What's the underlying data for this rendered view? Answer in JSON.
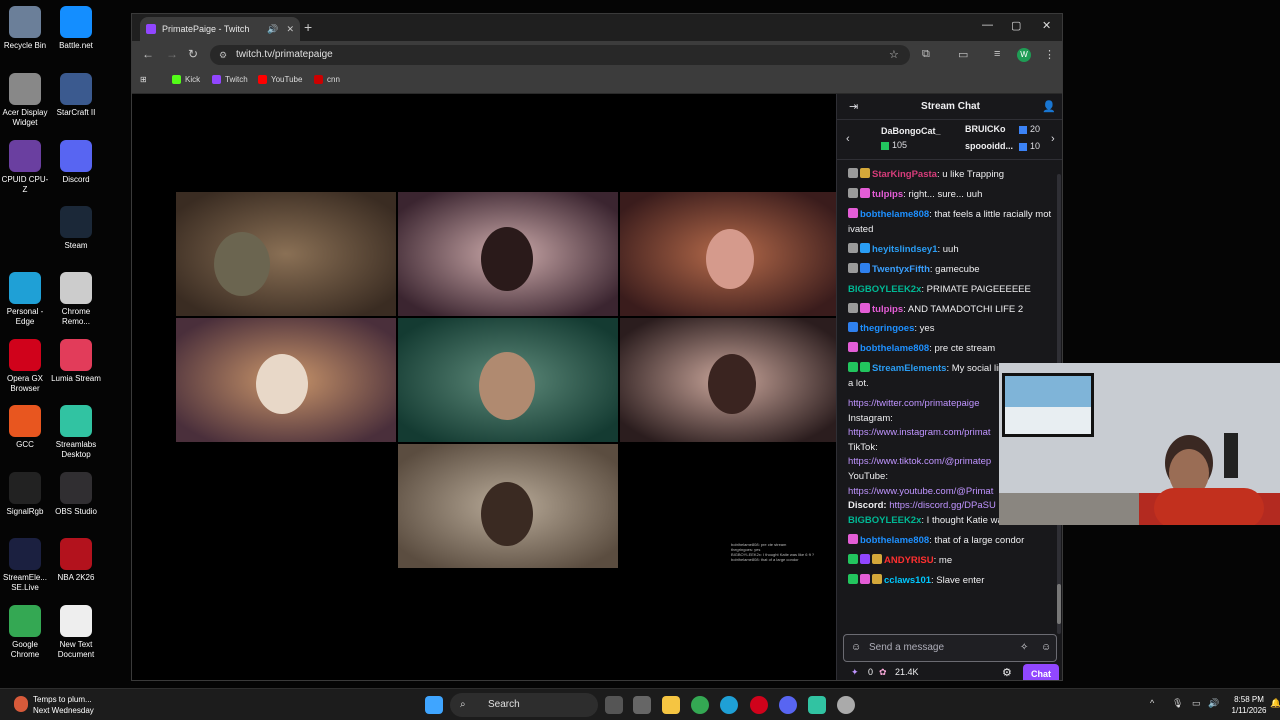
{
  "desktop": {
    "icons": [
      {
        "label": "Recycle Bin",
        "icon": "recycle-bin-icon",
        "color": "#6b7f99"
      },
      {
        "label": "Battle.net",
        "icon": "battlenet-icon",
        "color": "#148eff"
      },
      {
        "label": "Acer Display Widget",
        "icon": "acer-display-icon",
        "color": "#888888"
      },
      {
        "label": "StarCraft II",
        "icon": "starcraft-icon",
        "color": "#3b5a8f"
      },
      {
        "label": "CPUID CPU-Z",
        "icon": "cpuz-icon",
        "color": "#6a3fa0"
      },
      {
        "label": "Discord",
        "icon": "discord-icon",
        "color": "#5865f2"
      },
      {
        "label": "Steam",
        "icon": "steam-icon",
        "color": "#1b2838"
      },
      {
        "label": "Personal - Edge",
        "icon": "edge-icon",
        "color": "#1fa0d6"
      },
      {
        "label": "Chrome Remo...",
        "icon": "chrome-remote-icon",
        "color": "#cccccc"
      },
      {
        "label": "Opera GX Browser",
        "icon": "opera-gx-icon",
        "color": "#d0021b"
      },
      {
        "label": "Lumia Stream",
        "icon": "lumia-icon",
        "color": "#e23c5a"
      },
      {
        "label": "GCC",
        "icon": "gcc-icon",
        "color": "#e8561f"
      },
      {
        "label": "Streamlabs Desktop",
        "icon": "streamlabs-icon",
        "color": "#31c3a2"
      },
      {
        "label": "SignalRgb",
        "icon": "signalrgb-icon",
        "color": "#222222"
      },
      {
        "label": "OBS Studio",
        "icon": "obs-icon",
        "color": "#302e31"
      },
      {
        "label": "StreamEle... SE.Live",
        "icon": "streamelements-icon",
        "color": "#1b2040"
      },
      {
        "label": "NBA 2K26",
        "icon": "nba2k-icon",
        "color": "#b3121d"
      },
      {
        "label": "Google Chrome",
        "icon": "chrome-icon",
        "color": "#34a853"
      },
      {
        "label": "New Text Document",
        "icon": "text-document-icon",
        "color": "#eeeeee"
      }
    ]
  },
  "browser": {
    "tab_title": "PrimatePaige - Twitch",
    "url": "twitch.tv/primatepaige",
    "bookmarks": [
      {
        "label": "Kick",
        "color": "#53fc18"
      },
      {
        "label": "Twitch",
        "color": "#9146ff"
      },
      {
        "label": "YouTube",
        "color": "#ff0000"
      },
      {
        "label": "cnn",
        "color": "#cc0000"
      }
    ],
    "profile_initial": "W"
  },
  "overlay_chat": [
    "bobthelame808: pre cte stream",
    "thegringoes: yes",
    "BIGBOYLEEK2x: I thought Katie was like 6 ft ?",
    "bobthelame808: that of a large condor"
  ],
  "chat": {
    "title": "Stream Chat",
    "leaderboard": [
      {
        "name": "DaBongoCat_",
        "count": "105"
      },
      {
        "name": "BRUICKo",
        "count": "20"
      },
      {
        "name": "spoooidd...",
        "count": "10"
      }
    ],
    "messages": [
      {
        "user": "StarKingPasta",
        "color": "#d63c7a",
        "text": "u like Trapping",
        "badges": [
          "#9a9a9a",
          "#d4a83a"
        ]
      },
      {
        "user": "tulpips",
        "color": "#e45dd6",
        "text": "right... sure... uuh",
        "badges": [
          "#9a9a9a",
          "#e45dd6"
        ]
      },
      {
        "user": "bobthelame808",
        "color": "#1e90ff",
        "text": "that feels a little racially motivated",
        "badges": [
          "#e45dd6"
        ]
      },
      {
        "user": "heyitslindsey1",
        "color": "#2a9df4",
        "text": "uuh",
        "badges": [
          "#9a9a9a",
          "#2a9df4"
        ]
      },
      {
        "user": "TwentyxFifth",
        "color": "#3aa0ff",
        "text": "gamecube",
        "badges": [
          "#9a9a9a",
          "#2f80ed"
        ]
      },
      {
        "user": "BIGBOYLEEK2x",
        "color": "#00b894",
        "text": "PRIMATE PAIGEEEEEE",
        "badges": []
      },
      {
        "user": "tulpips",
        "color": "#e45dd6",
        "text": "AND TAMADOTCHI LIFE 2",
        "badges": [
          "#9a9a9a",
          "#e45dd6"
        ]
      },
      {
        "user": "thegringoes",
        "color": "#1e90ff",
        "text": "yes",
        "badges": [
          "#2f80ed"
        ]
      },
      {
        "user": "bobthelame808",
        "color": "#1e90ff",
        "text": "pre cte stream",
        "badges": [
          "#e45dd6"
        ]
      },
      {
        "user": "StreamElements",
        "color": "#2a9df4",
        "text": "My social links! I post.. a lot.",
        "badges": [
          "#22c55e",
          "#22c55e"
        ]
      },
      {
        "user": "",
        "color": "#bf94ff",
        "text": "https://twitter.com/primatepaige",
        "badges": []
      },
      {
        "user": "",
        "color": "#efeff1",
        "text": "Instagram:",
        "badges": []
      },
      {
        "user": "",
        "color": "#bf94ff",
        "text": "https://www.instagram.com/primat",
        "badges": []
      },
      {
        "user": "",
        "color": "#efeff1",
        "text": "TikTok:",
        "badges": []
      },
      {
        "user": "",
        "color": "#bf94ff",
        "text": "https://www.tiktok.com/@primatep",
        "badges": []
      },
      {
        "user": "",
        "color": "#efeff1",
        "text": "YouTube:",
        "badges": []
      },
      {
        "user": "",
        "color": "#bf94ff",
        "text": "https://www.youtube.com/@Primat",
        "badges": []
      },
      {
        "user": "Discord:",
        "color": "#efeff1",
        "text": "https://discord.gg/DPaSU",
        "badges": []
      },
      {
        "user": "BIGBOYLEEK2x",
        "color": "#00b894",
        "text": "I thought Katie was like 6 ft ?",
        "badges": []
      },
      {
        "user": "bobthelame808",
        "color": "#1e90ff",
        "text": "that of a large condor",
        "badges": [
          "#e45dd6"
        ]
      },
      {
        "user": "ANDYRISU",
        "color": "#ff3030",
        "text": "me",
        "badges": [
          "#22c55e",
          "#9146ff",
          "#d4a83a"
        ]
      },
      {
        "user": "cclaws101",
        "color": "#00c8ff",
        "text": "Slave enter",
        "badges": [
          "#22c55e",
          "#e45dd6",
          "#d4a83a"
        ]
      }
    ],
    "input_placeholder": "Send a message",
    "points": "0",
    "channel_points": "21.4K",
    "chat_button": "Chat"
  },
  "taskbar": {
    "weather_line1": "Temps to plum...",
    "weather_line2": "Next Wednesday",
    "search_label": "Search",
    "time": "8:58 PM",
    "date": "1/11/2026"
  }
}
